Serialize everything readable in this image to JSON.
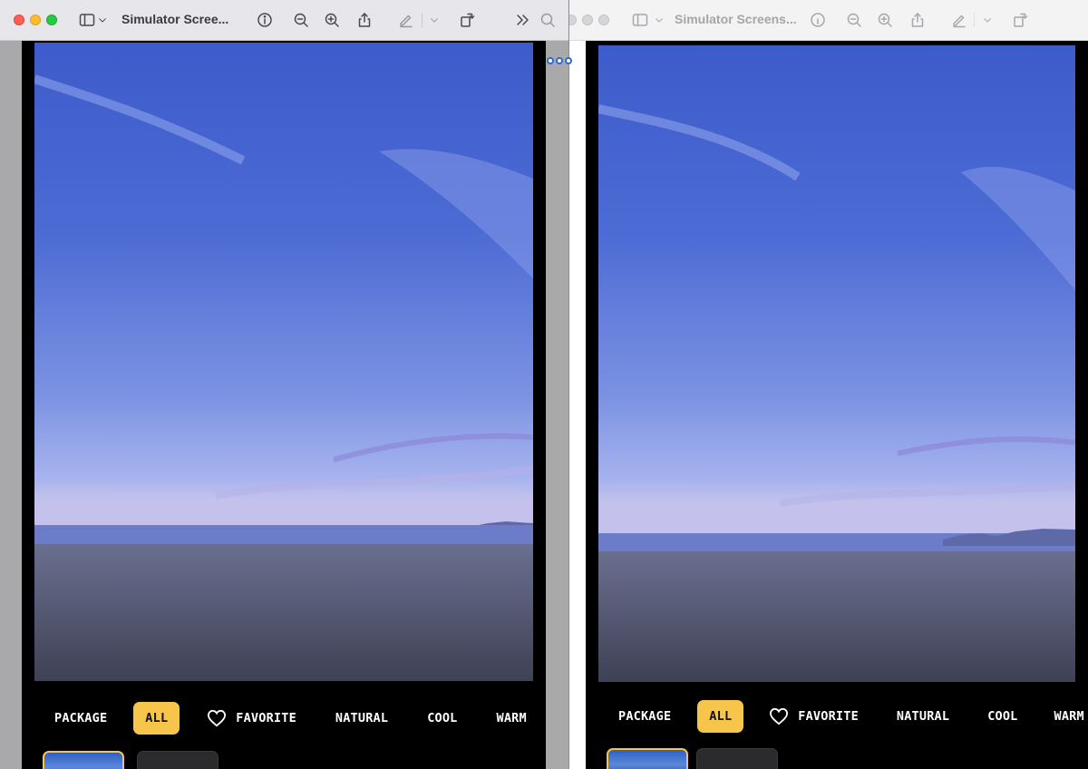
{
  "left_window": {
    "title": "Simulator Scree...",
    "filters": [
      "PACKAGE",
      "ALL",
      "FAVORITE",
      "NATURAL",
      "COOL",
      "WARM"
    ],
    "active_filter": "ALL"
  },
  "right_window": {
    "title": "Simulator Screens...",
    "filters": [
      "PACKAGE",
      "ALL",
      "FAVORITE",
      "NATURAL",
      "COOL",
      "WARM"
    ],
    "active_filter": "ALL"
  },
  "icons": {
    "sidebar": "sidebar-icon",
    "info": "info-icon",
    "zoom_out": "zoom-out-icon",
    "zoom_in": "zoom-in-icon",
    "share": "share-icon",
    "markup": "markup-pen-icon",
    "rotate": "rotate-icon",
    "more": "chevron-double-right-icon",
    "search": "search-icon",
    "favorite": "heart-icon"
  },
  "colors": {
    "accent": "#f6c54a",
    "selection_dots": "#2d6ad6"
  }
}
